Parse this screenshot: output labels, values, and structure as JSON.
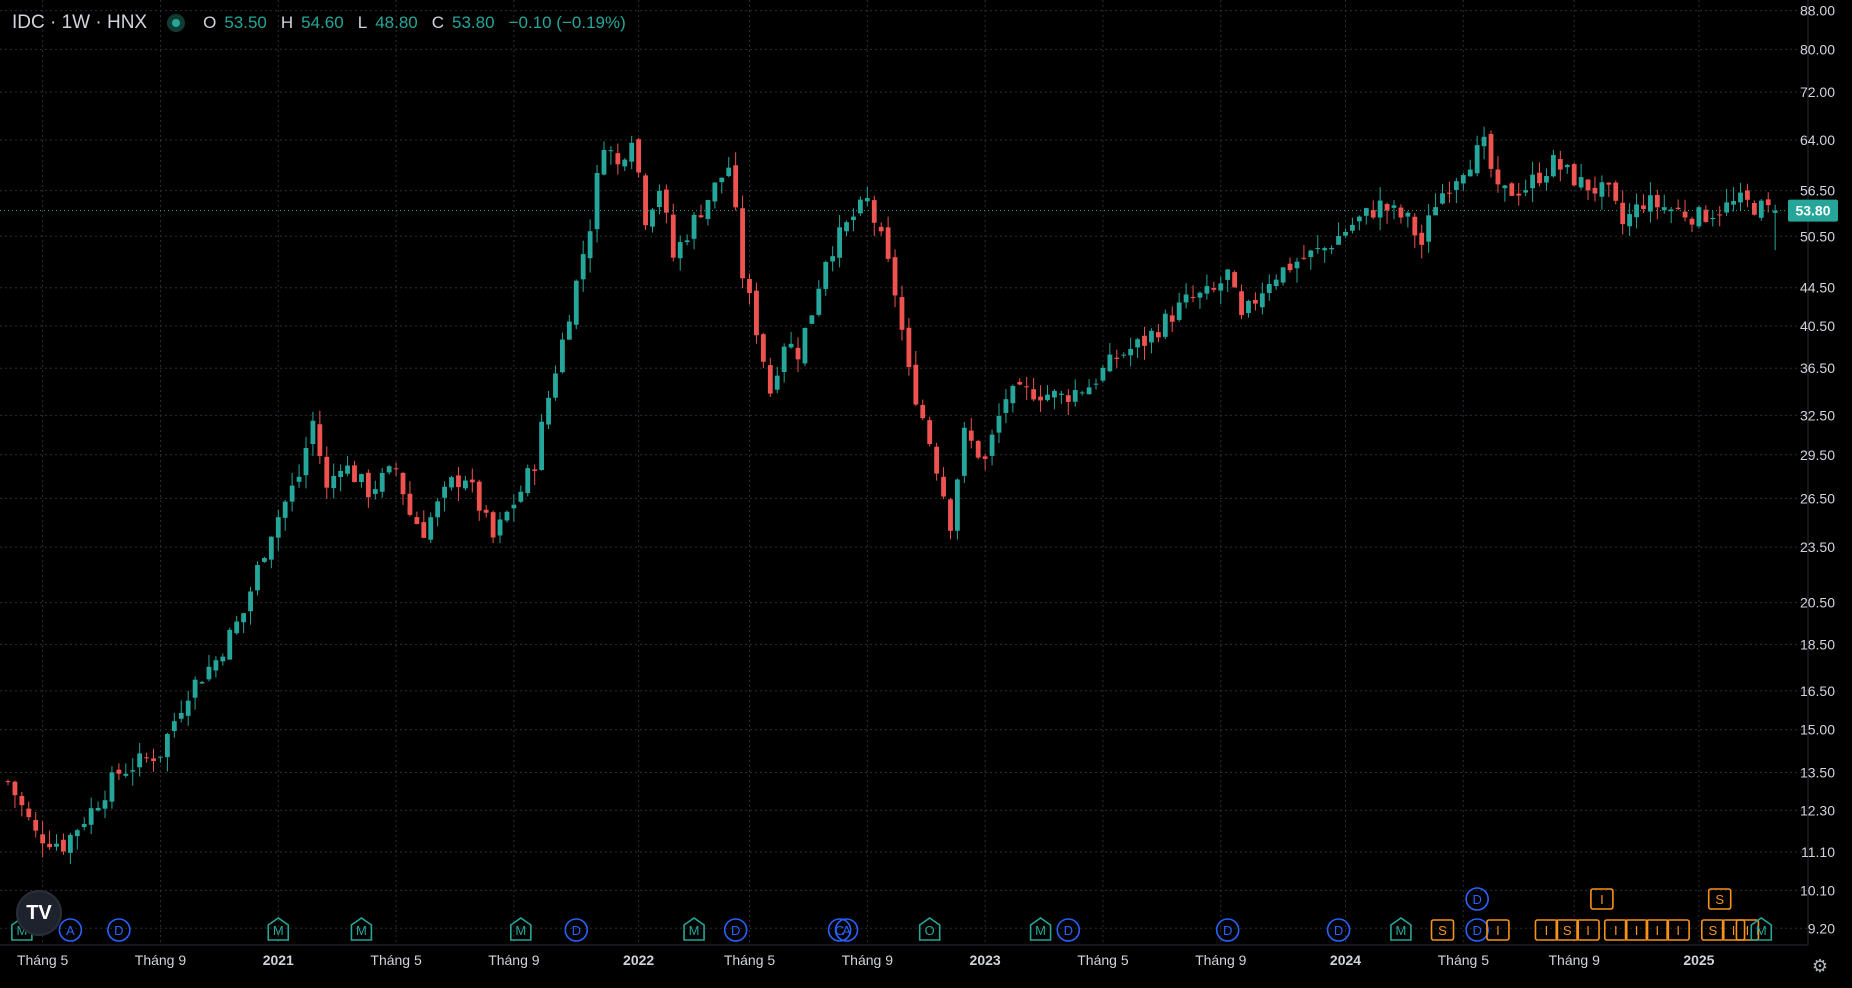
{
  "legend": {
    "symbol": "IDC · 1W · HNX",
    "o_label": "O",
    "o_value": "53.50",
    "h_label": "H",
    "h_value": "54.60",
    "l_label": "L",
    "l_value": "48.80",
    "c_label": "C",
    "c_value": "53.80",
    "change": "−0.10 (−0.19%)"
  },
  "colors": {
    "up": "#26a69a",
    "down": "#ef5350",
    "grid": "#2a2e39",
    "axis_text": "#d1d4dc",
    "price_badge": "#26a69a",
    "marker_m": "#26a69a",
    "marker_d": "#2962ff",
    "marker_orange": "#f7931a"
  },
  "icons": {
    "logo": "tradingview-logo-icon",
    "settings": "settings-icon",
    "live_dot": "live-status-dot-icon"
  },
  "logo_text": "TV",
  "current_price": "53.80",
  "chart_data": {
    "type": "candlestick",
    "title": "IDC · 1W · HNX",
    "y_scale": "log",
    "ylim": [
      8.7,
      89
    ],
    "grid": true,
    "y_ticks": [
      "88.00",
      "80.00",
      "72.00",
      "64.00",
      "56.50",
      "50.50",
      "44.50",
      "40.50",
      "36.50",
      "32.50",
      "29.50",
      "26.50",
      "23.50",
      "20.50",
      "18.50",
      "16.50",
      "15.00",
      "13.50",
      "12.30",
      "11.10",
      "10.10",
      "9.20"
    ],
    "x_ticks": [
      {
        "label": "Tháng 5",
        "bold": false,
        "index": 5
      },
      {
        "label": "Tháng 9",
        "bold": false,
        "index": 22
      },
      {
        "label": "2021",
        "bold": true,
        "index": 39
      },
      {
        "label": "Tháng 5",
        "bold": false,
        "index": 56
      },
      {
        "label": "Tháng 9",
        "bold": false,
        "index": 73
      },
      {
        "label": "2022",
        "bold": true,
        "index": 91
      },
      {
        "label": "Tháng 5",
        "bold": false,
        "index": 107
      },
      {
        "label": "Tháng 9",
        "bold": false,
        "index": 124
      },
      {
        "label": "2023",
        "bold": true,
        "index": 141
      },
      {
        "label": "Tháng 5",
        "bold": false,
        "index": 158
      },
      {
        "label": "Tháng 9",
        "bold": false,
        "index": 175
      },
      {
        "label": "2024",
        "bold": true,
        "index": 193
      },
      {
        "label": "Tháng 5",
        "bold": false,
        "index": 210
      },
      {
        "label": "Tháng 9",
        "bold": false,
        "index": 226
      },
      {
        "label": "2025",
        "bold": true,
        "index": 244
      }
    ],
    "anchors": [
      [
        0,
        13.2
      ],
      [
        4,
        11.6
      ],
      [
        8,
        11.3
      ],
      [
        12,
        12.3
      ],
      [
        16,
        13.5
      ],
      [
        22,
        14.2
      ],
      [
        26,
        16.5
      ],
      [
        30,
        17.8
      ],
      [
        34,
        20.0
      ],
      [
        38,
        24.5
      ],
      [
        42,
        28.0
      ],
      [
        44,
        32.0
      ],
      [
        46,
        27.0
      ],
      [
        48,
        29.0
      ],
      [
        52,
        27.0
      ],
      [
        56,
        28.5
      ],
      [
        58,
        25.5
      ],
      [
        60,
        24.5
      ],
      [
        64,
        27.5
      ],
      [
        66,
        28.0
      ],
      [
        70,
        24.0
      ],
      [
        74,
        27.0
      ],
      [
        76,
        29.0
      ],
      [
        78,
        34.0
      ],
      [
        80,
        39.0
      ],
      [
        82,
        45.0
      ],
      [
        84,
        52.0
      ],
      [
        86,
        64.0
      ],
      [
        88,
        60.0
      ],
      [
        90,
        65.0
      ],
      [
        92,
        53.0
      ],
      [
        94,
        57.0
      ],
      [
        96,
        48.0
      ],
      [
        100,
        54.0
      ],
      [
        104,
        60.0
      ],
      [
        106,
        46.0
      ],
      [
        110,
        34.5
      ],
      [
        112,
        39.0
      ],
      [
        114,
        38.0
      ],
      [
        116,
        42.0
      ],
      [
        118,
        48.0
      ],
      [
        122,
        53.0
      ],
      [
        124,
        55.0
      ],
      [
        126,
        50.0
      ],
      [
        128,
        44.0
      ],
      [
        130,
        36.0
      ],
      [
        133,
        30.5
      ],
      [
        136,
        25.0
      ],
      [
        138,
        31.0
      ],
      [
        141,
        29.0
      ],
      [
        144,
        34.0
      ],
      [
        148,
        34.5
      ],
      [
        152,
        34.0
      ],
      [
        156,
        35.0
      ],
      [
        160,
        37.5
      ],
      [
        164,
        39.0
      ],
      [
        170,
        43.0
      ],
      [
        174,
        44.0
      ],
      [
        176,
        46.0
      ],
      [
        178,
        41.0
      ],
      [
        182,
        45.5
      ],
      [
        186,
        47.5
      ],
      [
        190,
        49.0
      ],
      [
        194,
        52.0
      ],
      [
        198,
        54.5
      ],
      [
        202,
        52.5
      ],
      [
        204,
        49.5
      ],
      [
        206,
        55.0
      ],
      [
        210,
        60.0
      ],
      [
        213,
        63.0
      ],
      [
        215,
        56.0
      ],
      [
        219,
        57.0
      ],
      [
        223,
        60.5
      ],
      [
        227,
        57.5
      ],
      [
        231,
        56.0
      ],
      [
        233,
        52.0
      ],
      [
        236,
        55.0
      ],
      [
        240,
        54.0
      ],
      [
        244,
        53.0
      ],
      [
        247,
        54.0
      ],
      [
        250,
        55.0
      ],
      [
        254,
        53.8
      ]
    ],
    "last_candle": {
      "open": 53.5,
      "high": 54.6,
      "low": 48.8,
      "close": 53.8
    },
    "markers": [
      {
        "index": 2,
        "letter": "M",
        "kind": "m",
        "row": 0
      },
      {
        "index": 9,
        "letter": "A",
        "kind": "d",
        "row": 0
      },
      {
        "index": 16,
        "letter": "D",
        "kind": "d",
        "row": 0
      },
      {
        "index": 39,
        "letter": "M",
        "kind": "m",
        "row": 0
      },
      {
        "index": 51,
        "letter": "M",
        "kind": "m",
        "row": 0
      },
      {
        "index": 74,
        "letter": "M",
        "kind": "m",
        "row": 0
      },
      {
        "index": 82,
        "letter": "D",
        "kind": "d",
        "row": 0
      },
      {
        "index": 99,
        "letter": "M",
        "kind": "m",
        "row": 0
      },
      {
        "index": 105,
        "letter": "D",
        "kind": "d",
        "row": 0
      },
      {
        "index": 120,
        "letter": "C",
        "kind": "d",
        "row": 0
      },
      {
        "index": 121,
        "letter": "A",
        "kind": "d",
        "row": 0
      },
      {
        "index": 133,
        "letter": "O",
        "kind": "m",
        "row": 0
      },
      {
        "index": 149,
        "letter": "M",
        "kind": "m",
        "row": 0
      },
      {
        "index": 153,
        "letter": "D",
        "kind": "d",
        "row": 0
      },
      {
        "index": 176,
        "letter": "D",
        "kind": "d",
        "row": 0
      },
      {
        "index": 192,
        "letter": "D",
        "kind": "d",
        "row": 0
      },
      {
        "index": 201,
        "letter": "M",
        "kind": "m",
        "row": 0
      },
      {
        "index": 207,
        "letter": "S",
        "kind": "o",
        "row": 0
      },
      {
        "index": 212,
        "letter": "D",
        "kind": "d",
        "row": 0
      },
      {
        "index": 212,
        "letter": "D",
        "kind": "d",
        "row": 1
      },
      {
        "index": 215,
        "letter": "I",
        "kind": "o",
        "row": 0
      },
      {
        "index": 222,
        "letter": "I",
        "kind": "o",
        "row": 0
      },
      {
        "index": 225,
        "letter": "S",
        "kind": "o",
        "row": 0
      },
      {
        "index": 228,
        "letter": "I",
        "kind": "o",
        "row": 0
      },
      {
        "index": 230,
        "letter": "I",
        "kind": "o",
        "row": 1
      },
      {
        "index": 232,
        "letter": "I",
        "kind": "o",
        "row": 0
      },
      {
        "index": 235,
        "letter": "I",
        "kind": "o",
        "row": 0
      },
      {
        "index": 238,
        "letter": "I",
        "kind": "o",
        "row": 0
      },
      {
        "index": 241,
        "letter": "I",
        "kind": "o",
        "row": 0
      },
      {
        "index": 246,
        "letter": "S",
        "kind": "o",
        "row": 0
      },
      {
        "index": 247,
        "letter": "S",
        "kind": "o",
        "row": 1
      },
      {
        "index": 249,
        "letter": "I",
        "kind": "o",
        "row": 0
      },
      {
        "index": 251,
        "letter": "I",
        "kind": "o",
        "row": 0
      },
      {
        "index": 253,
        "letter": "M",
        "kind": "m",
        "row": 0
      }
    ]
  }
}
